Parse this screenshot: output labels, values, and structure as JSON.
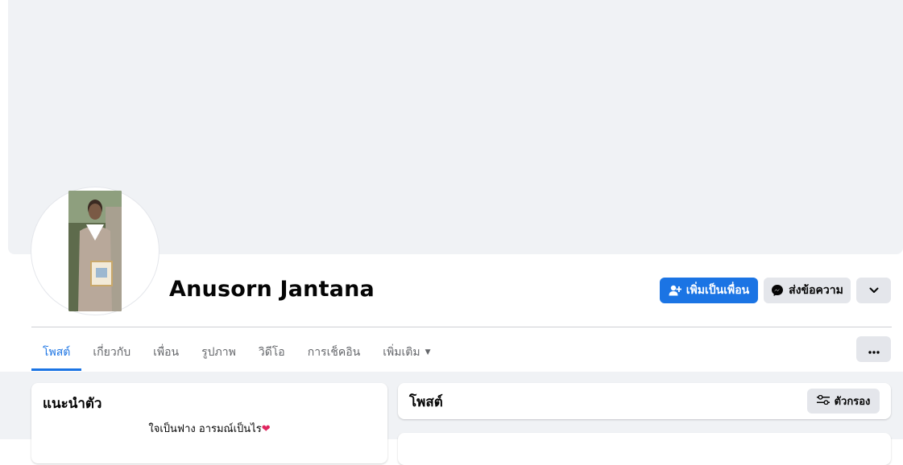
{
  "profile": {
    "name": "Anusorn Jantana"
  },
  "actions": {
    "add_friend_label": "เพิ่มเป็นเพื่อน",
    "message_label": "ส่งข้อความ"
  },
  "tabs": [
    {
      "label": "โพสต์",
      "active": true
    },
    {
      "label": "เกี่ยวกับ",
      "active": false
    },
    {
      "label": "เพื่อน",
      "active": false
    },
    {
      "label": "รูปภาพ",
      "active": false
    },
    {
      "label": "วิดีโอ",
      "active": false
    },
    {
      "label": "การเช็คอิน",
      "active": false
    },
    {
      "label": "เพิ่มเติม",
      "active": false
    }
  ],
  "intro": {
    "title": "แนะนำตัว",
    "bio": "ใจเป็นฟาง อารมณ์เป็นไร"
  },
  "posts": {
    "title": "โพสต์",
    "filter_label": "ตัวกรอง"
  },
  "colors": {
    "accent": "#1b74e4",
    "cover": "#f0f2f5",
    "secondary_button": "#e4e6eb"
  },
  "icons": {
    "add_friend": "person-plus-icon",
    "message": "messenger-icon",
    "dropdown": "chevron-down-icon",
    "more": "ellipsis-icon",
    "filter": "sliders-icon"
  }
}
